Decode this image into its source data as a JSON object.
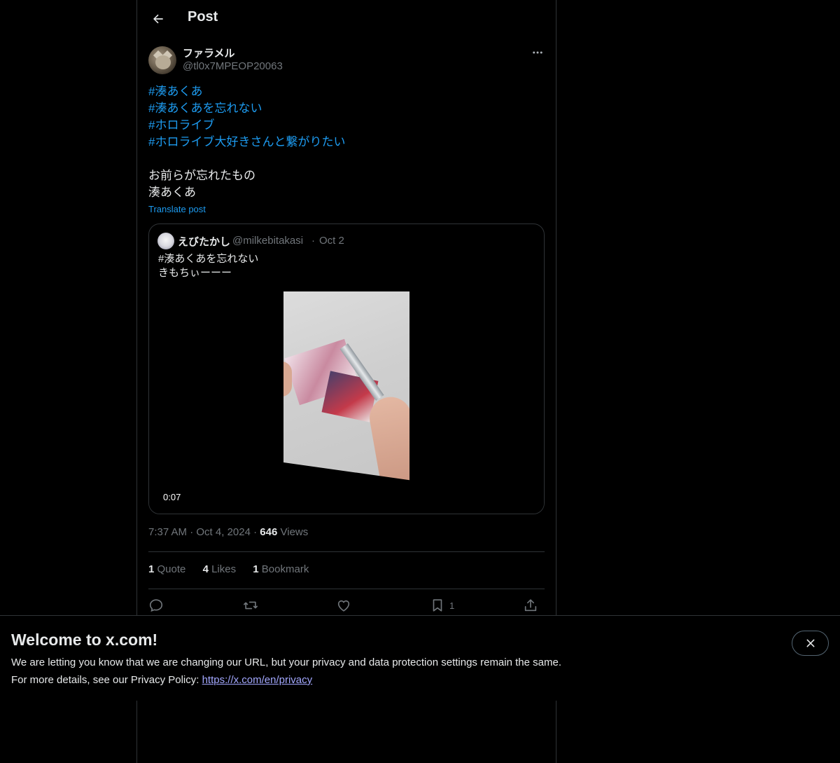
{
  "header": {
    "title": "Post"
  },
  "author": {
    "display_name": "ファラメル",
    "handle": "@tl0x7MPEOP20063"
  },
  "post": {
    "hashtags": [
      "#湊あくあ",
      "#湊あくあを忘れない",
      "#ホロライブ",
      "#ホロライブ大好きさんと繋がりたい"
    ],
    "lines": [
      "お前らが忘れたもの",
      "湊あくあ"
    ],
    "translate_label": "Translate post"
  },
  "quote": {
    "display_name": "えびたかし",
    "handle": "@milkebitakasi",
    "separator": "·",
    "date": "Oct 2",
    "lines": [
      "#湊あくあを忘れない",
      "きもちぃーーー"
    ],
    "video_duration": "0:07"
  },
  "meta": {
    "time": "7:37 AM",
    "separator": "·",
    "date": "Oct 4, 2024",
    "views_count": "646",
    "views_label": "Views"
  },
  "stats": {
    "quotes_count": "1",
    "quotes_label": "Quote",
    "likes_count": "4",
    "likes_label": "Likes",
    "bookmarks_count": "1",
    "bookmarks_label": "Bookmark"
  },
  "actions": {
    "reply_icon": "reply-icon",
    "repost_icon": "repost-icon",
    "like_icon": "heart-icon",
    "bookmark_icon": "bookmark-icon",
    "bookmark_count": "1",
    "share_icon": "share-icon"
  },
  "banner": {
    "title": "Welcome to x.com!",
    "line1": "We are letting you know that we are changing our URL, but your privacy and data protection settings remain the same.",
    "line2_prefix": "For more details, see our Privacy Policy: ",
    "link_text": "https://x.com/en/privacy"
  },
  "colors": {
    "accent": "#1d9bf0",
    "background": "#000000",
    "muted": "#71767b",
    "border": "#2f3336",
    "link": "#a3a8ff"
  }
}
